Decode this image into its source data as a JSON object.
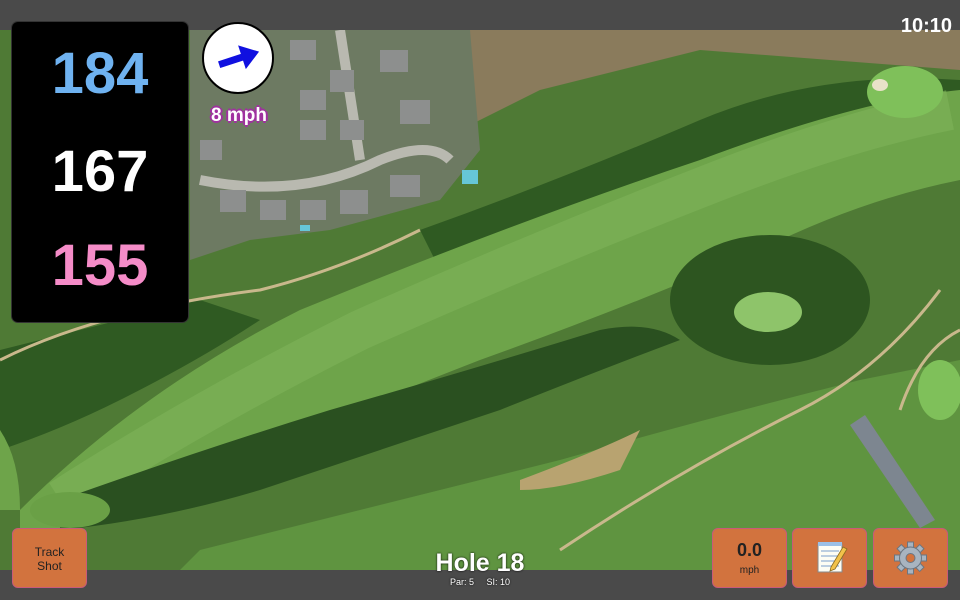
{
  "status": {
    "time": "10:10"
  },
  "distances": {
    "back": "184",
    "middle": "167",
    "front": "155"
  },
  "wind": {
    "speed_label": "8 mph",
    "icon": "wind-arrow-icon"
  },
  "buttons": {
    "track_shot_line1": "Track",
    "track_shot_line2": "Shot",
    "speed_value": "0.0",
    "speed_unit": "mph",
    "notes_icon": "notepad-icon",
    "settings_icon": "gear-icon"
  },
  "hole": {
    "title": "Hole 18",
    "par": "Par: 5",
    "si": "SI: 10"
  },
  "colors": {
    "back": "#6fb2f0",
    "middle": "#ffffff",
    "front": "#f58cc8",
    "button": "#d2733e",
    "arrow": "#1010e0"
  }
}
